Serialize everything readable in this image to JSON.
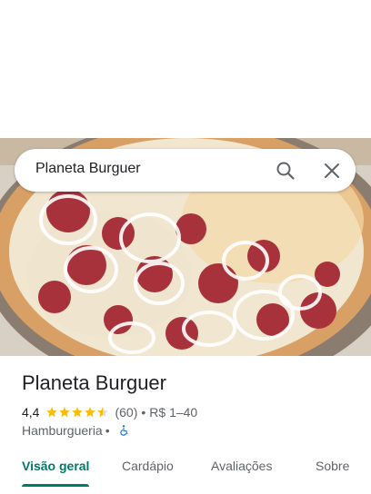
{
  "search": {
    "value": "Planeta Burguer",
    "search_icon": "search-icon",
    "close_icon": "close-icon"
  },
  "hero": {
    "image_description": "pizza-photo"
  },
  "place": {
    "name": "Planeta Burguer",
    "rating": "4,4",
    "stars_value": 4.4,
    "review_count": "(60)",
    "price_range": "R$ 1–40",
    "category": "Hamburgueria",
    "accessibility_icon": "wheelchair-icon",
    "separator": "•"
  },
  "tabs": [
    {
      "label": "Visão geral",
      "active": true
    },
    {
      "label": "Cardápio",
      "active": false
    },
    {
      "label": "Avaliações",
      "active": false
    },
    {
      "label": "Sobre",
      "active": false
    }
  ],
  "colors": {
    "accent": "#00796b",
    "star": "#fbbc04",
    "accessibility": "#1a73e8"
  }
}
